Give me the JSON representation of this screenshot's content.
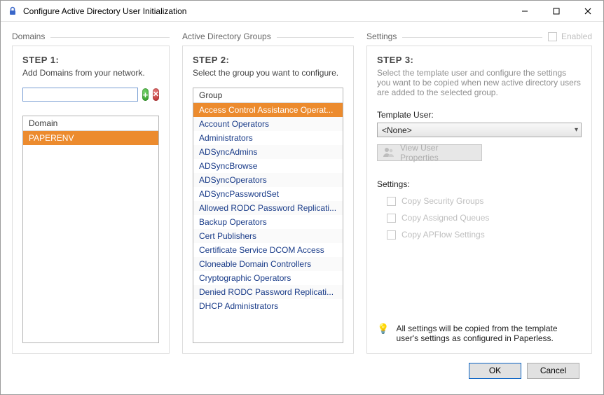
{
  "window": {
    "title": "Configure Active Directory User Initialization",
    "lock_icon": "🔒"
  },
  "domains": {
    "legend": "Domains",
    "step": "STEP 1:",
    "subtitle": "Add Domains from your network.",
    "input_value": "",
    "add_tooltip": "Add",
    "remove_tooltip": "Remove",
    "header": "Domain",
    "items": [
      "PAPERENV"
    ],
    "selected_index": 0
  },
  "groups": {
    "legend": "Active Directory Groups",
    "step": "STEP 2:",
    "subtitle": "Select the group you want to configure.",
    "header": "Group",
    "selected_index": 0,
    "items": [
      "Access Control Assistance Operat...",
      "Account Operators",
      "Administrators",
      "ADSyncAdmins",
      "ADSyncBrowse",
      "ADSyncOperators",
      "ADSyncPasswordSet",
      "Allowed RODC Password Replicati...",
      "Backup Operators",
      "Cert Publishers",
      "Certificate Service DCOM Access",
      "Cloneable Domain Controllers",
      "Cryptographic Operators",
      "Denied RODC Password Replicati...",
      "DHCP Administrators"
    ]
  },
  "settings": {
    "legend": "Settings",
    "enabled_label": "Enabled",
    "enabled_checked": false,
    "step": "STEP 3:",
    "subtitle": "Select the template user and configure the settings you want to be copied when new active directory users are added to the selected group.",
    "template_label": "Template User:",
    "template_value": "<None>",
    "view_properties_label": "View User Properties",
    "settings_label": "Settings:",
    "checkboxes": [
      {
        "label": "Copy Security Groups",
        "checked": false
      },
      {
        "label": "Copy Assigned Queues",
        "checked": false
      },
      {
        "label": "Copy APFlow Settings",
        "checked": false
      }
    ],
    "hint": "All settings will be copied from the template user's settings as configured in Paperless."
  },
  "buttons": {
    "ok": "OK",
    "cancel": "Cancel"
  }
}
